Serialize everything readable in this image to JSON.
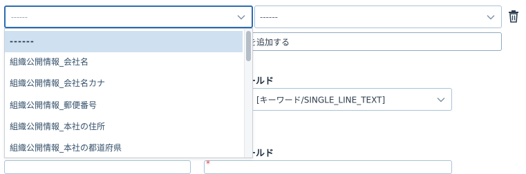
{
  "top_left_select": {
    "value": "------"
  },
  "top_right_select": {
    "value": "------"
  },
  "add_button": {
    "label": "を追加する"
  },
  "field_section_1": {
    "label_fragment": "ールド"
  },
  "keyword_select": {
    "value": "[キーワード/SINGLE_LINE_TEXT]"
  },
  "field_section_2": {
    "label_fragment": "ールド",
    "required_mark": "*"
  },
  "dropdown": {
    "options": [
      "------",
      "組織公開情報_会社名",
      "組織公開情報_会社名カナ",
      "組織公開情報_郵便番号",
      "組織公開情報_本社の住所",
      "組織公開情報_本社の都道府県"
    ],
    "selected_index": 0
  },
  "colors": {
    "accent": "#2b6cb0",
    "selected_bg": "#cfe0f0",
    "required": "#e53e3e"
  }
}
